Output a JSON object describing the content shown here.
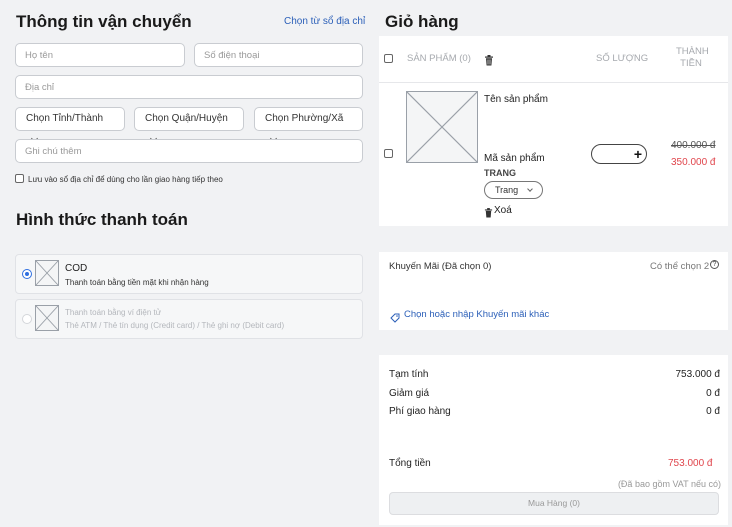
{
  "shipping": {
    "title": "Thông tin vận chuyển",
    "address_book_link": "Chọn từ sổ địa chỉ",
    "name_placeholder": "Họ tên",
    "phone_placeholder": "Số điện thoại",
    "address_placeholder": "Địa chỉ",
    "province_select": "Chọn Tỉnh/Thành",
    "district_select": "Chọn Quận/Huyện",
    "ward_select": "Chọn Phường/Xã",
    "note_placeholder": "Ghi chú thêm",
    "save_address_label": "Lưu vào sổ địa chỉ để dùng cho lần giao hàng tiếp theo"
  },
  "payment": {
    "title": "Hình thức thanh toán",
    "methods": [
      {
        "name": "COD",
        "desc": "Thanh toán bằng tiền mặt khi nhận hàng",
        "selected": true
      },
      {
        "name": "Thanh toán bằng ví điện tử",
        "desc": "Thẻ ATM / Thẻ tín dụng (Credit card) / Thẻ ghi nợ (Debit card)",
        "selected": false
      }
    ]
  },
  "cart": {
    "title": "Giỏ hàng",
    "col_product": "SẢN PHẨM (0)",
    "col_qty": "SỐ LƯỢNG",
    "col_total_1": "THÀNH",
    "col_total_2": "TIỀN",
    "item": {
      "name": "Tên sản phẩm",
      "code": "Mã sản phẩm",
      "variant_label": "TRANG",
      "variant_value": "Trang",
      "remove_label": "Xoá",
      "old_price": "400.000 đ",
      "price": "350.000 đ",
      "qty_plus": "+"
    }
  },
  "promo": {
    "title": "Khuyến Mãi (Đã chọn 0)",
    "hint": "Có thể chọn 2",
    "select_link": "Chọn hoặc nhập Khuyến mãi khác"
  },
  "summary": {
    "subtotal_label": "Tạm tính",
    "subtotal_value": "753.000 đ",
    "discount_label": "Giảm giá",
    "discount_value": "0 đ",
    "shipping_label": "Phí giao hàng",
    "shipping_value": "0 đ",
    "total_label": "Tổng tiền",
    "total_value": "753.000 đ",
    "vat_note": "(Đã bao gồm VAT nếu có)",
    "buy_button": "Mua Hàng (0)"
  },
  "colors": {
    "accent_blue": "#2b5fb8",
    "price_red": "#e0454c",
    "radio_blue": "#2f6fe0"
  }
}
